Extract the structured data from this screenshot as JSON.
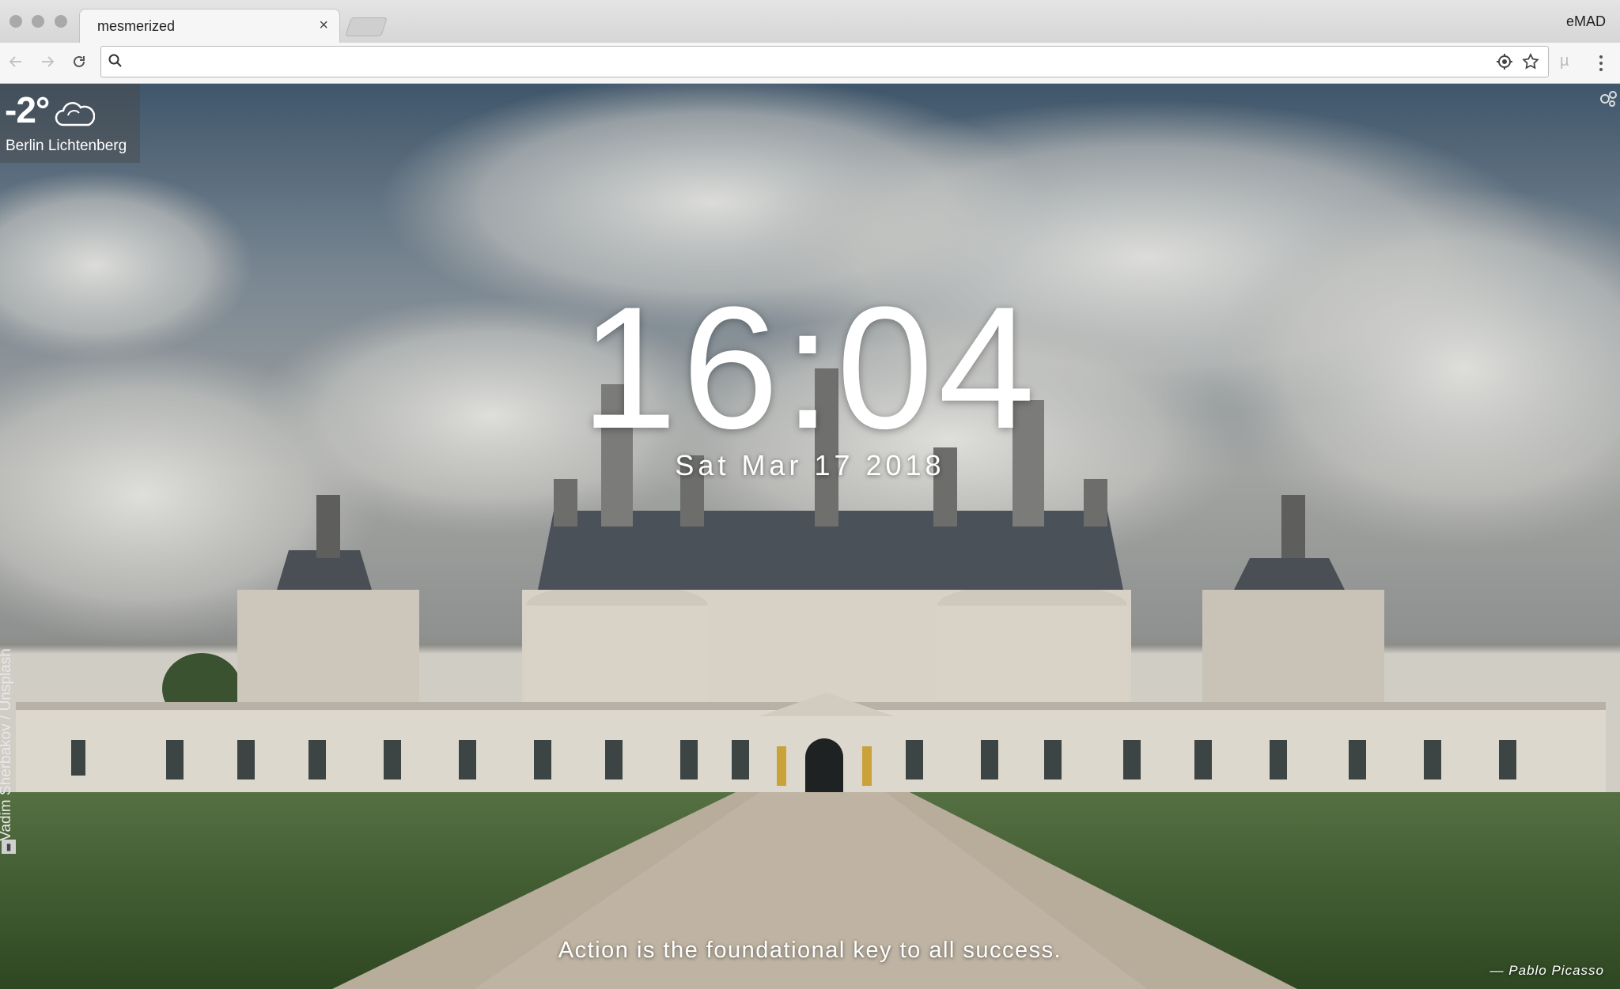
{
  "browser": {
    "tab_title": "mesmerized",
    "tab_close": "×",
    "profile_name": "eMAD",
    "address_value": "",
    "address_placeholder": ""
  },
  "weather": {
    "temperature": "-2°",
    "condition_icon": "cloud-icon",
    "location": "Berlin Lichtenberg"
  },
  "clock": {
    "time": "16:04",
    "date": "Sat Mar 17 2018"
  },
  "photo_credit": "Vadim Sherbakov / Unsplash",
  "quote": {
    "text": "Action is the foundational key to all success.",
    "author": "—  Pablo Picasso"
  },
  "colors": {
    "sky_top": "#4c6276",
    "lawn": "#3d5a2c",
    "path": "#b9ad9a",
    "building": "#ddd8cd"
  }
}
